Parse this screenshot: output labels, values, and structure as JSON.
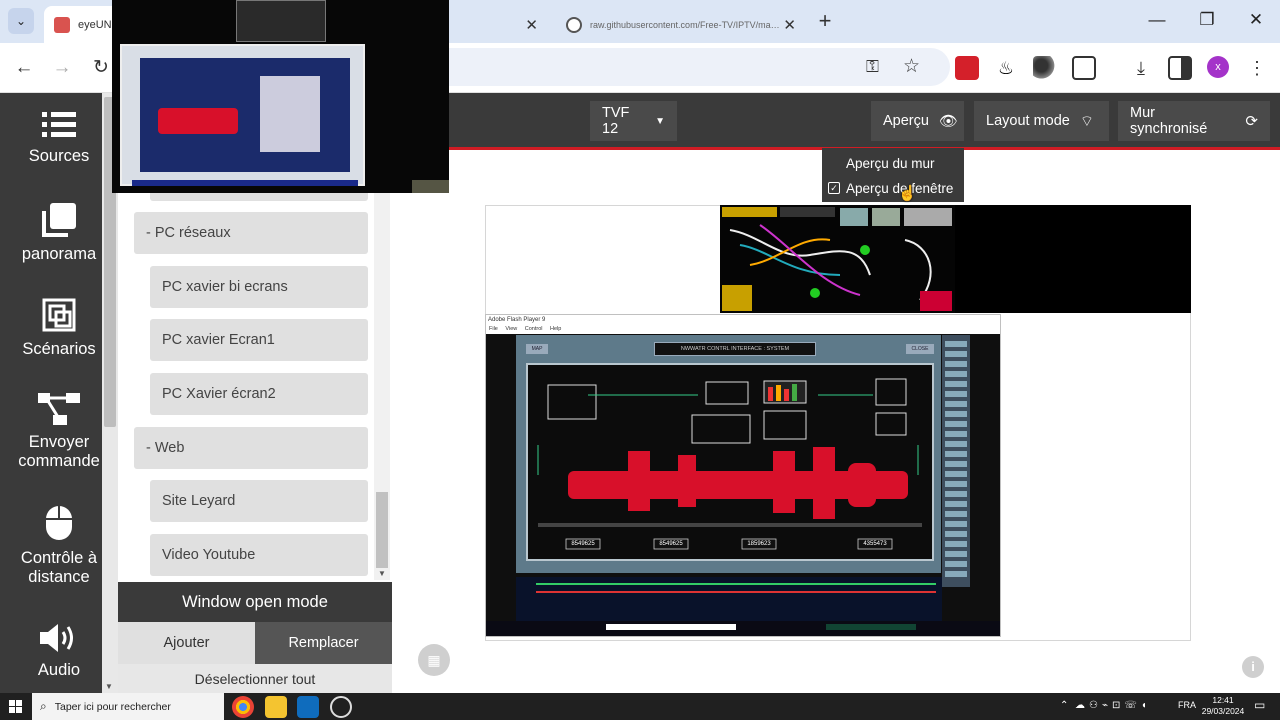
{
  "browser": {
    "tabs": [
      {
        "title": "eyeUNIFY",
        "active": true
      },
      {
        "title": "",
        "active": false
      },
      {
        "title": "raw.githubusercontent.com/Free-TV/IPTV/master/play",
        "active": false
      }
    ],
    "address": ""
  },
  "nav": {
    "items": [
      {
        "label": "Sources",
        "icon": "list-icon"
      },
      {
        "label": "panorama",
        "icon": "panorama-icon"
      },
      {
        "label": "Scénarios",
        "icon": "scenarios-icon"
      },
      {
        "label": "Envoyer commande",
        "icon": "send-command-icon"
      },
      {
        "label": "Contrôle à distance",
        "icon": "mouse-icon"
      },
      {
        "label": "Audio",
        "icon": "speaker-icon"
      }
    ]
  },
  "sources": {
    "items": [
      {
        "label": "- PC réseaux",
        "type": "group"
      },
      {
        "label": "PC xavier bi ecrans",
        "type": "item"
      },
      {
        "label": "PC xavier Ecran1",
        "type": "item"
      },
      {
        "label": "PC Xavier écran2",
        "type": "item"
      },
      {
        "label": "- Web",
        "type": "group"
      },
      {
        "label": "Site Leyard",
        "type": "item"
      },
      {
        "label": "Video Youtube",
        "type": "item"
      }
    ],
    "window_open_mode": "Window open mode",
    "add_label": "Ajouter",
    "replace_label": "Remplacer",
    "deselect_label": "Déselectionner tout"
  },
  "header": {
    "wall_select": "TVF 12",
    "preview_label": "Aperçu",
    "layout_label": "Layout mode",
    "sync_label": "Mur synchronisé",
    "dropdown": {
      "wall_preview": "Aperçu du mur",
      "window_preview": "Aperçu de fenêtre",
      "window_preview_checked": true
    }
  },
  "wall": {
    "flash_title": "Adobe Flash Player 9",
    "flash_menu": [
      "File",
      "View",
      "Control",
      "Help"
    ],
    "hmi_title": "NWWATR CONTRL INTERFACE : SYSTEM",
    "hmi_buttons": [
      "MAP",
      "CLOSE"
    ],
    "hmi_counters": [
      "8549625",
      "8549625",
      "1859623",
      "4355473"
    ]
  },
  "taskbar": {
    "search_placeholder": "Taper ici pour rechercher",
    "language": "FRA",
    "time": "12:41",
    "date": "29/03/2024"
  },
  "colors": {
    "nav_bg": "#3a3a3a",
    "accent_red": "#d01c24",
    "machine_red": "#d8102a",
    "profile": "#a433c9"
  }
}
